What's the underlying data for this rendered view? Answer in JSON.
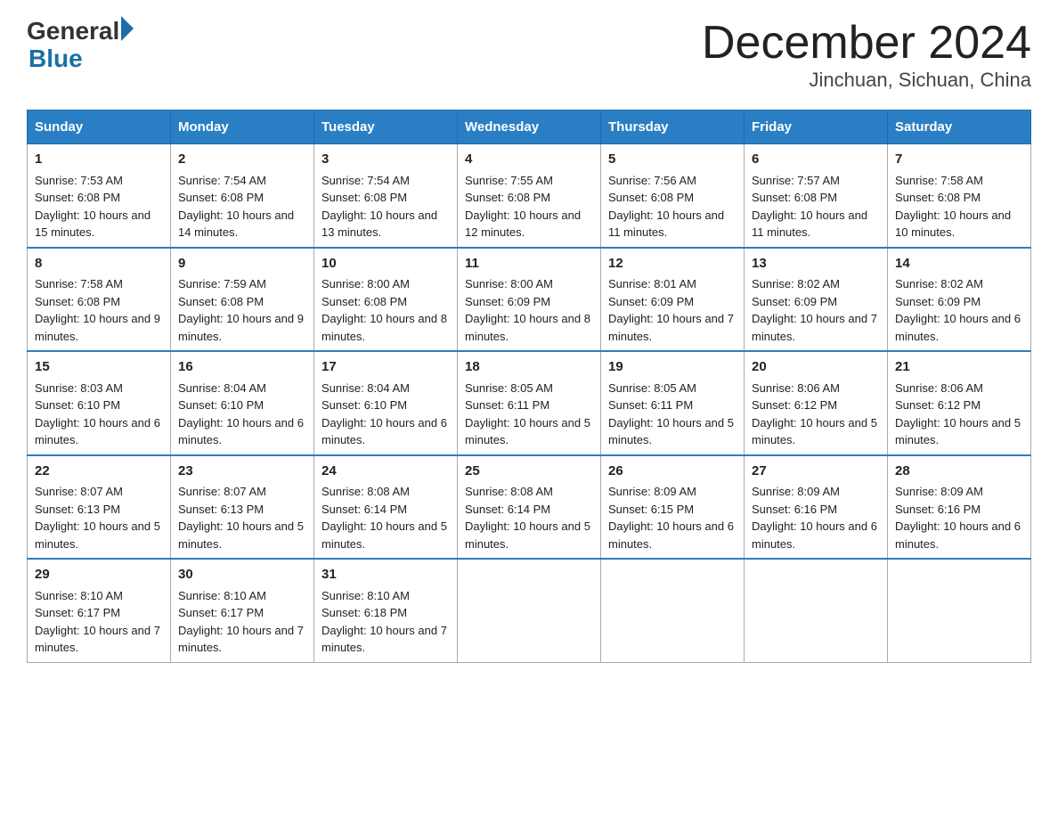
{
  "header": {
    "logo_general": "General",
    "logo_blue": "Blue",
    "month_title": "December 2024",
    "location": "Jinchuan, Sichuan, China"
  },
  "days_of_week": [
    "Sunday",
    "Monday",
    "Tuesday",
    "Wednesday",
    "Thursday",
    "Friday",
    "Saturday"
  ],
  "weeks": [
    [
      {
        "day": "1",
        "sunrise": "7:53 AM",
        "sunset": "6:08 PM",
        "daylight": "10 hours and 15 minutes."
      },
      {
        "day": "2",
        "sunrise": "7:54 AM",
        "sunset": "6:08 PM",
        "daylight": "10 hours and 14 minutes."
      },
      {
        "day": "3",
        "sunrise": "7:54 AM",
        "sunset": "6:08 PM",
        "daylight": "10 hours and 13 minutes."
      },
      {
        "day": "4",
        "sunrise": "7:55 AM",
        "sunset": "6:08 PM",
        "daylight": "10 hours and 12 minutes."
      },
      {
        "day": "5",
        "sunrise": "7:56 AM",
        "sunset": "6:08 PM",
        "daylight": "10 hours and 11 minutes."
      },
      {
        "day": "6",
        "sunrise": "7:57 AM",
        "sunset": "6:08 PM",
        "daylight": "10 hours and 11 minutes."
      },
      {
        "day": "7",
        "sunrise": "7:58 AM",
        "sunset": "6:08 PM",
        "daylight": "10 hours and 10 minutes."
      }
    ],
    [
      {
        "day": "8",
        "sunrise": "7:58 AM",
        "sunset": "6:08 PM",
        "daylight": "10 hours and 9 minutes."
      },
      {
        "day": "9",
        "sunrise": "7:59 AM",
        "sunset": "6:08 PM",
        "daylight": "10 hours and 9 minutes."
      },
      {
        "day": "10",
        "sunrise": "8:00 AM",
        "sunset": "6:08 PM",
        "daylight": "10 hours and 8 minutes."
      },
      {
        "day": "11",
        "sunrise": "8:00 AM",
        "sunset": "6:09 PM",
        "daylight": "10 hours and 8 minutes."
      },
      {
        "day": "12",
        "sunrise": "8:01 AM",
        "sunset": "6:09 PM",
        "daylight": "10 hours and 7 minutes."
      },
      {
        "day": "13",
        "sunrise": "8:02 AM",
        "sunset": "6:09 PM",
        "daylight": "10 hours and 7 minutes."
      },
      {
        "day": "14",
        "sunrise": "8:02 AM",
        "sunset": "6:09 PM",
        "daylight": "10 hours and 6 minutes."
      }
    ],
    [
      {
        "day": "15",
        "sunrise": "8:03 AM",
        "sunset": "6:10 PM",
        "daylight": "10 hours and 6 minutes."
      },
      {
        "day": "16",
        "sunrise": "8:04 AM",
        "sunset": "6:10 PM",
        "daylight": "10 hours and 6 minutes."
      },
      {
        "day": "17",
        "sunrise": "8:04 AM",
        "sunset": "6:10 PM",
        "daylight": "10 hours and 6 minutes."
      },
      {
        "day": "18",
        "sunrise": "8:05 AM",
        "sunset": "6:11 PM",
        "daylight": "10 hours and 5 minutes."
      },
      {
        "day": "19",
        "sunrise": "8:05 AM",
        "sunset": "6:11 PM",
        "daylight": "10 hours and 5 minutes."
      },
      {
        "day": "20",
        "sunrise": "8:06 AM",
        "sunset": "6:12 PM",
        "daylight": "10 hours and 5 minutes."
      },
      {
        "day": "21",
        "sunrise": "8:06 AM",
        "sunset": "6:12 PM",
        "daylight": "10 hours and 5 minutes."
      }
    ],
    [
      {
        "day": "22",
        "sunrise": "8:07 AM",
        "sunset": "6:13 PM",
        "daylight": "10 hours and 5 minutes."
      },
      {
        "day": "23",
        "sunrise": "8:07 AM",
        "sunset": "6:13 PM",
        "daylight": "10 hours and 5 minutes."
      },
      {
        "day": "24",
        "sunrise": "8:08 AM",
        "sunset": "6:14 PM",
        "daylight": "10 hours and 5 minutes."
      },
      {
        "day": "25",
        "sunrise": "8:08 AM",
        "sunset": "6:14 PM",
        "daylight": "10 hours and 5 minutes."
      },
      {
        "day": "26",
        "sunrise": "8:09 AM",
        "sunset": "6:15 PM",
        "daylight": "10 hours and 6 minutes."
      },
      {
        "day": "27",
        "sunrise": "8:09 AM",
        "sunset": "6:16 PM",
        "daylight": "10 hours and 6 minutes."
      },
      {
        "day": "28",
        "sunrise": "8:09 AM",
        "sunset": "6:16 PM",
        "daylight": "10 hours and 6 minutes."
      }
    ],
    [
      {
        "day": "29",
        "sunrise": "8:10 AM",
        "sunset": "6:17 PM",
        "daylight": "10 hours and 7 minutes."
      },
      {
        "day": "30",
        "sunrise": "8:10 AM",
        "sunset": "6:17 PM",
        "daylight": "10 hours and 7 minutes."
      },
      {
        "day": "31",
        "sunrise": "8:10 AM",
        "sunset": "6:18 PM",
        "daylight": "10 hours and 7 minutes."
      },
      null,
      null,
      null,
      null
    ]
  ],
  "labels": {
    "sunrise_prefix": "Sunrise: ",
    "sunset_prefix": "Sunset: ",
    "daylight_prefix": "Daylight: "
  }
}
